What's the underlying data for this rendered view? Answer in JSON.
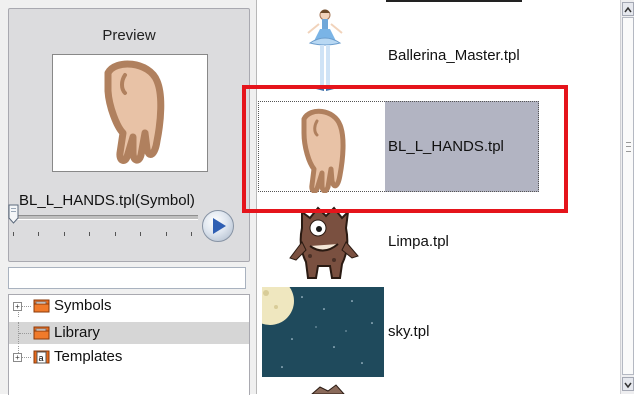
{
  "preview": {
    "title": "Preview",
    "symbol_name": "BL_L_HANDS.tpl(Symbol)",
    "slider_position": 0
  },
  "search": {
    "value": "",
    "placeholder": ""
  },
  "tree": {
    "items": [
      {
        "label": "Symbols",
        "expandable": true,
        "selected": false
      },
      {
        "label": "Library",
        "expandable": false,
        "selected": true
      },
      {
        "label": "Templates",
        "expandable": true,
        "selected": false
      }
    ]
  },
  "templates": {
    "items": [
      {
        "name": "Ballerina_Master.tpl",
        "thumbnail": "ballerina-thumbnail"
      },
      {
        "name": "BL_L_HANDS.tpl",
        "thumbnail": "hand-thumbnail",
        "selected": true
      },
      {
        "name": "Limpa.tpl",
        "thumbnail": "monster-thumbnail"
      },
      {
        "name": "sky.tpl",
        "thumbnail": "night-sky-thumbnail"
      }
    ]
  },
  "colors": {
    "highlight": "#e5141b",
    "selection": "#b2b4c2",
    "hand_fill": "#e8c2a6",
    "hand_outline": "#b0805e"
  }
}
